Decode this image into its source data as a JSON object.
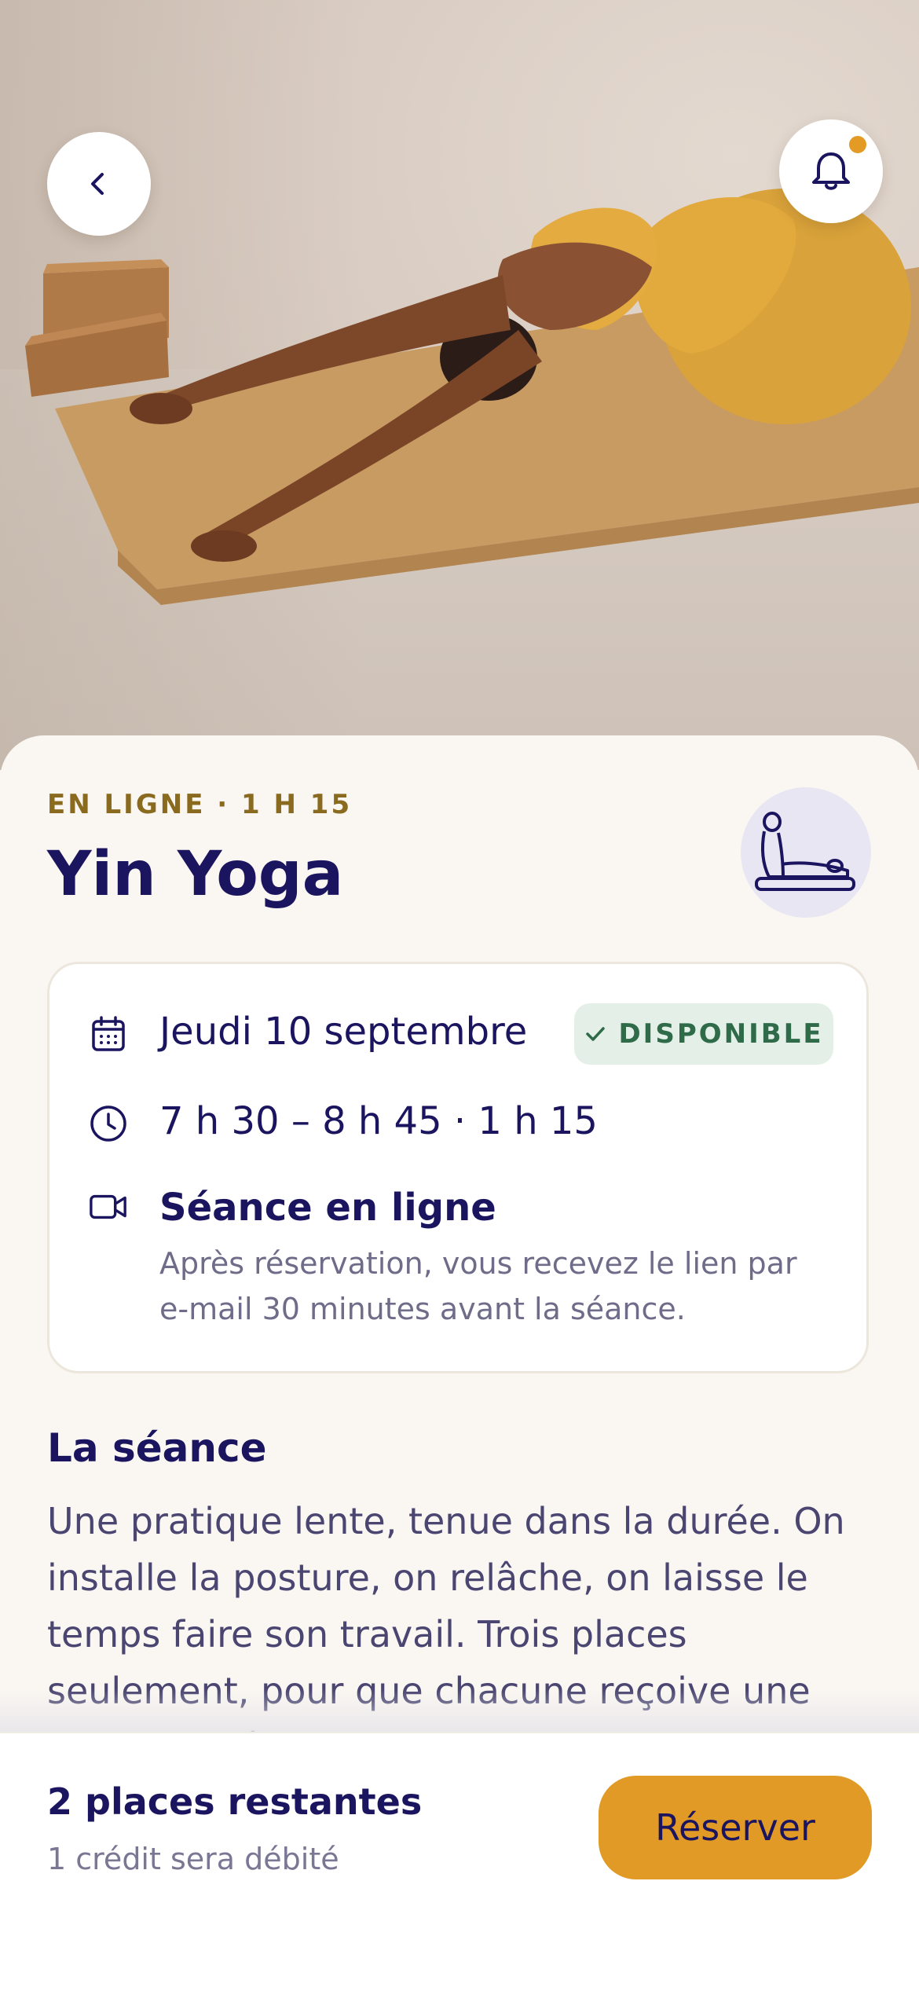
{
  "hero": {
    "image_icon": "yoga-photo",
    "back_icon": "chevron-left-icon",
    "bell_icon": "bell-icon",
    "has_notification": true
  },
  "session": {
    "meta": "EN LIGNE · 1 H 15",
    "title": "Yin Yoga",
    "pose_icon": "childs-pose-icon"
  },
  "details": {
    "date": "Jeudi 10 septembre",
    "status": "DISPONIBLE",
    "time": "7 h 30 – 8 h 45 · 1 h 15",
    "online_title": "Séance en ligne",
    "online_desc": "Après réservation, vous recevez le lien par e-mail 30 minutes avant la séance."
  },
  "description": {
    "title": "La séance",
    "text": "Une pratique lente, tenue dans la durée. On installe la posture, on relâche, on laisse le temps faire son travail. Trois places seulement, pour que chacune reçoive une attention réelle."
  },
  "footer": {
    "places": "2 places restantes",
    "credit": "1 crédit sera débité",
    "reserve_label": "Réserver"
  },
  "colors": {
    "accent": "#e09a25",
    "primary": "#1b1560",
    "status_green": "#2f6b49"
  }
}
